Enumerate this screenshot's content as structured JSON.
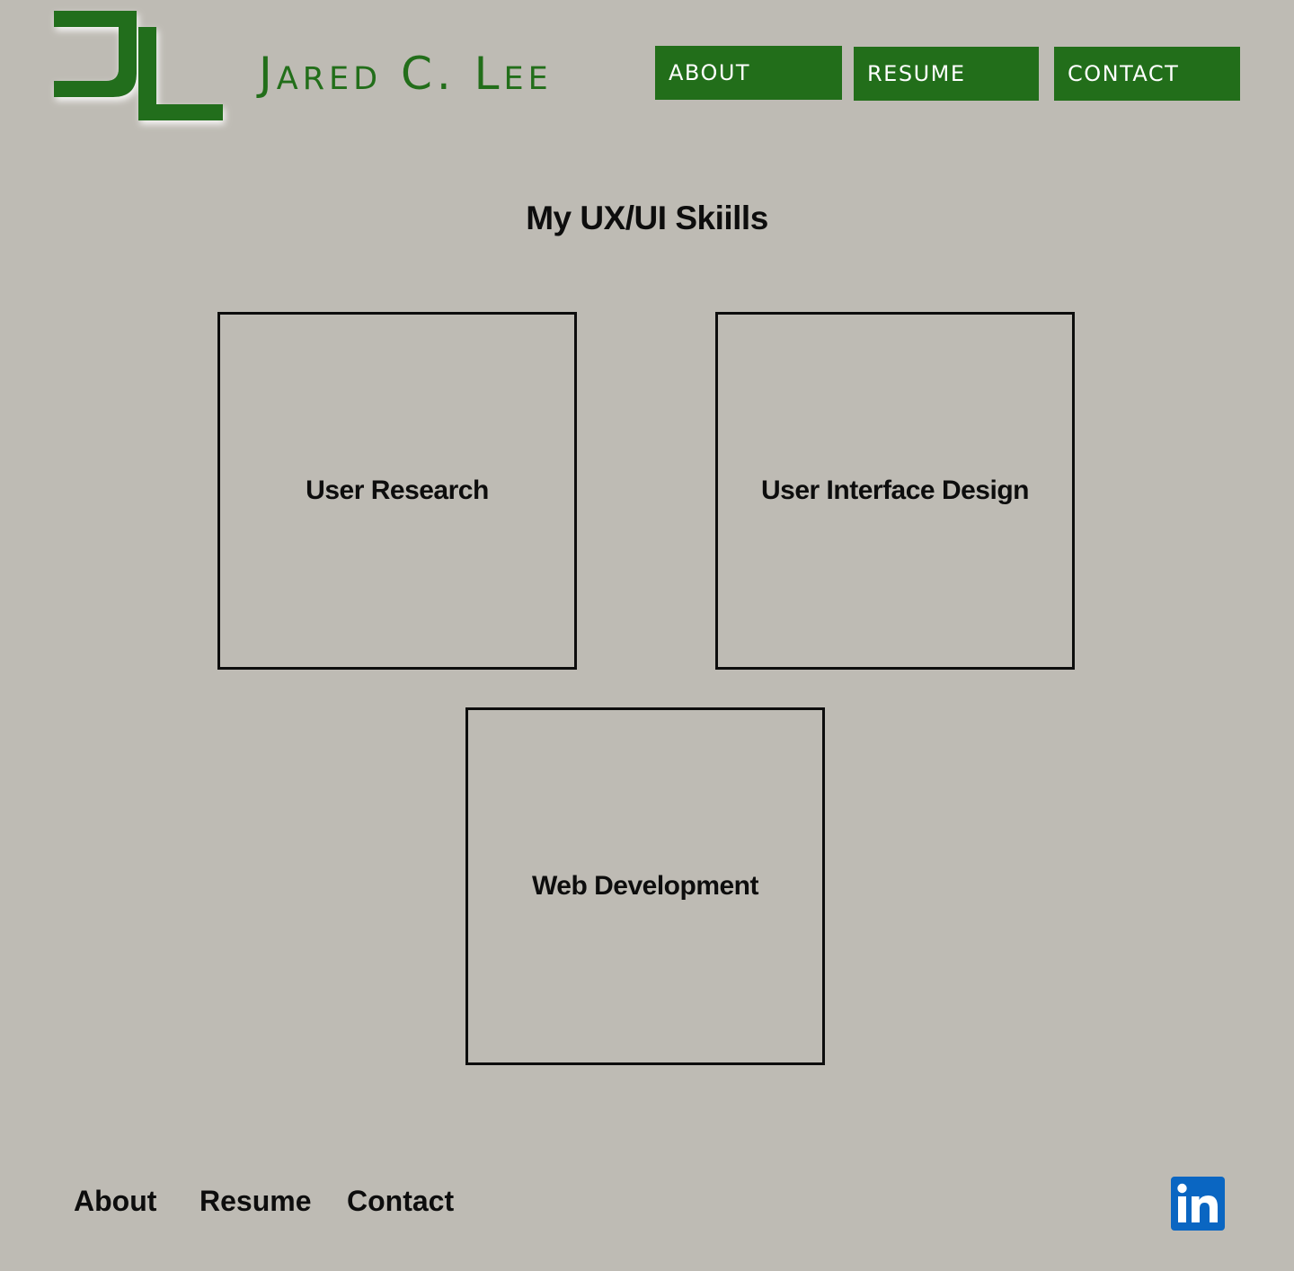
{
  "header": {
    "logo": {
      "icon": "jl-monogram-logo",
      "monogram": "JL",
      "color": "#226e1a"
    },
    "site_name": "Jared C. Lee",
    "nav": [
      {
        "label": "ABOUT"
      },
      {
        "label": "RESUME"
      },
      {
        "label": "CONTACT"
      }
    ]
  },
  "main": {
    "title": "My UX/UI Skiills",
    "skills": [
      {
        "label": "User Research"
      },
      {
        "label": "User Interface Design"
      },
      {
        "label": "Web Development"
      }
    ]
  },
  "footer": {
    "links": [
      {
        "label": "About"
      },
      {
        "label": "Resume"
      },
      {
        "label": "Contact"
      }
    ],
    "social": {
      "icon": "linkedin-icon",
      "color": "#0a66c2"
    }
  },
  "colors": {
    "background": "#bebbb4",
    "accent": "#226e1a",
    "text": "#0d0d0d",
    "button_text": "#ffffff"
  }
}
